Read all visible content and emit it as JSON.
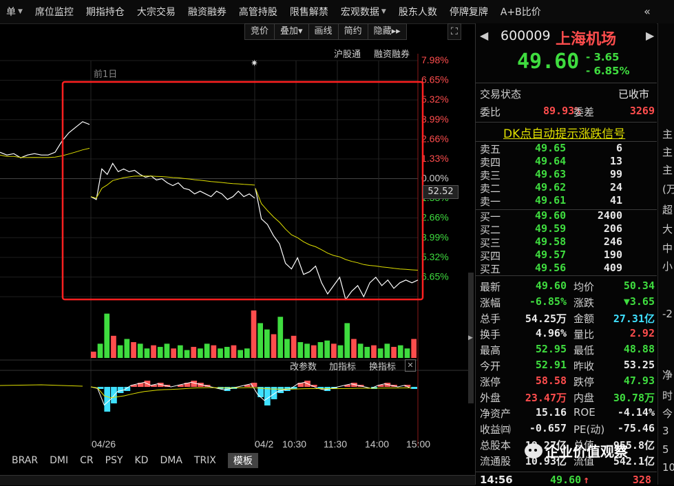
{
  "menu": [
    "单",
    "席位监控",
    "期指持仓",
    "大宗交易",
    "融资融券",
    "高管持股",
    "限售解禁",
    "宏观数据",
    "股东人数",
    "停牌复牌",
    "A+B比价"
  ],
  "menu_dropdown": [
    true,
    false,
    false,
    false,
    false,
    false,
    false,
    true,
    false,
    false,
    false
  ],
  "menu_more": "«",
  "toolbar": [
    "竞价",
    "叠加▾",
    "画线",
    "简约",
    "隐藏▸▸"
  ],
  "toolbar_expand": "⛶",
  "chart_links": [
    "沪股通",
    "融资融券"
  ],
  "prev_day_label": "前1日",
  "price_cursor": "52.52",
  "sub_buttons": [
    "改参数",
    "加指标",
    "换指标"
  ],
  "sub_close": "✕",
  "indicator_tabs": [
    "BRAR",
    "DMI",
    "CR",
    "PSY",
    "KD",
    "DMA",
    "TRIX",
    "模板"
  ],
  "indicator_active": "模板",
  "chart_data": {
    "type": "line",
    "x_labels": [
      "04/26",
      "04/2",
      "10:30",
      "11:30",
      "14:00",
      "15:00"
    ],
    "y_ticks_right": [
      "7.98%",
      "6.65%",
      "5.32%",
      "3.99%",
      "2.66%",
      "1.33%",
      "0.00%",
      "1.33%",
      "2.66%",
      "3.99%",
      "5.32%",
      "6.65%"
    ],
    "prev_close": 53.25,
    "series": [
      {
        "segment": "prev_day",
        "values": [
          54.2,
          54.1,
          54.15,
          54.0,
          54.1,
          54.15,
          54.1,
          54.1,
          54.2,
          54.6,
          54.9,
          55.1,
          55.3,
          55.2
        ]
      },
      {
        "segment": "prev_day_tail",
        "values": [
          52.6,
          52.5,
          53.6,
          53.4,
          53.8,
          53.5,
          53.6,
          53.5,
          53.55,
          53.4,
          53.3,
          53.35,
          53.2,
          53.25,
          53.1,
          53.0,
          53.1,
          52.9,
          52.85,
          52.7,
          52.8,
          52.7,
          52.6,
          52.8,
          52.7,
          52.5,
          52.6,
          52.8,
          52.6,
          52.7,
          52.55
        ]
      },
      {
        "segment": "today",
        "values": [
          52.9,
          51.8,
          51.6,
          51.2,
          50.9,
          50.2,
          50.0,
          50.4,
          49.8,
          49.9,
          50.1,
          49.5,
          49.1,
          49.4,
          49.7,
          48.9,
          49.2,
          49.4,
          49.0,
          49.5,
          49.7,
          49.4,
          49.6,
          49.3,
          49.5,
          49.6,
          49.5,
          49.6
        ]
      }
    ],
    "volume": [
      4,
      9,
      28,
      14,
      8,
      12,
      10,
      9,
      6,
      8,
      7,
      9,
      6,
      8,
      5,
      7,
      6,
      9,
      8,
      6,
      7,
      8,
      5,
      6,
      30,
      22,
      18,
      15,
      26,
      12,
      14,
      10,
      9,
      8,
      10,
      11,
      9,
      8,
      22,
      12,
      9,
      7,
      8,
      6,
      9,
      7,
      8,
      6,
      12
    ],
    "macd": [
      0,
      -1,
      -12,
      -8,
      -3,
      -2,
      1,
      2,
      3,
      1,
      2,
      1,
      0,
      1,
      2,
      3,
      2,
      1,
      0,
      -1,
      -2,
      -1,
      0,
      1,
      2,
      -5,
      -9,
      -6,
      -3,
      -2,
      -1,
      2,
      3,
      1,
      -1,
      -2,
      -1,
      0,
      1,
      2,
      1,
      0,
      -1,
      1,
      2,
      1,
      0,
      1,
      -1
    ]
  },
  "quote": {
    "code": "600009",
    "name": "上海机场",
    "price": "49.60",
    "change": "- 3.65",
    "change_pct": "- 6.85%",
    "status_label": "交易状态",
    "status_value": "已收市",
    "wb_label": "委比",
    "wb_value": "89.93%",
    "wc_label": "委差",
    "wc_value": "3269",
    "signal_link": "DK点自动提示涨跌信号"
  },
  "asks": [
    {
      "label": "卖五",
      "price": "49.65",
      "vol": "6"
    },
    {
      "label": "卖四",
      "price": "49.64",
      "vol": "13"
    },
    {
      "label": "卖三",
      "price": "49.63",
      "vol": "99"
    },
    {
      "label": "卖二",
      "price": "49.62",
      "vol": "24"
    },
    {
      "label": "卖一",
      "price": "49.61",
      "vol": "41"
    }
  ],
  "bids": [
    {
      "label": "买一",
      "price": "49.60",
      "vol": "2400"
    },
    {
      "label": "买二",
      "price": "49.59",
      "vol": "206"
    },
    {
      "label": "买三",
      "price": "49.58",
      "vol": "246"
    },
    {
      "label": "买四",
      "price": "49.57",
      "vol": "190"
    },
    {
      "label": "买五",
      "price": "49.56",
      "vol": "409"
    }
  ],
  "stats": [
    {
      "l1": "最新",
      "v1": "49.60",
      "c1": "g",
      "l2": "均价",
      "v2": "50.34",
      "c2": "g"
    },
    {
      "l1": "涨幅",
      "v1": "-6.85%",
      "c1": "g",
      "l2": "涨跌",
      "v2": "▼3.65",
      "c2": "g"
    },
    {
      "l1": "总手",
      "v1": "54.25万",
      "c1": "w",
      "l2": "金额",
      "v2": "27.31亿",
      "c2": "c"
    },
    {
      "l1": "换手",
      "v1": "4.96%",
      "c1": "w",
      "l2": "量比",
      "v2": "2.92",
      "c2": "r"
    },
    {
      "l1": "最高",
      "v1": "52.95",
      "c1": "g",
      "l2": "最低",
      "v2": "48.88",
      "c2": "g"
    },
    {
      "l1": "今开",
      "v1": "52.91",
      "c1": "g",
      "l2": "昨收",
      "v2": "53.25",
      "c2": "w"
    },
    {
      "l1": "涨停",
      "v1": "58.58",
      "c1": "r",
      "l2": "跌停",
      "v2": "47.93",
      "c2": "g"
    },
    {
      "l1": "外盘",
      "v1": "23.47万",
      "c1": "r",
      "l2": "内盘",
      "v2": "30.78万",
      "c2": "g"
    },
    {
      "l1": "净资产",
      "v1": "15.16",
      "c1": "w",
      "l2": "ROE",
      "v2": "-4.14%",
      "c2": "w"
    },
    {
      "l1": "收益㈣",
      "v1": "-0.657",
      "c1": "w",
      "l2": "PE(动)",
      "v2": "-75.46",
      "c2": "w"
    },
    {
      "l1": "总股本",
      "v1": "19.27亿",
      "c1": "w",
      "l2": "总值",
      "v2": "955.8亿",
      "c2": "w"
    },
    {
      "l1": "流通股",
      "v1": "10.93亿",
      "c1": "w",
      "l2": "流值",
      "v2": "542.1亿",
      "c2": "w"
    }
  ],
  "tick": {
    "time": "14:56",
    "price": "49.60",
    "arrow": "↑",
    "vol": "328"
  },
  "watermark": "企业价值观察",
  "far_right": [
    "主",
    "主",
    "主",
    "(万",
    "超",
    "大",
    "中",
    "小",
    "-2",
    "净",
    "时",
    "今",
    "3",
    "5",
    "10"
  ]
}
